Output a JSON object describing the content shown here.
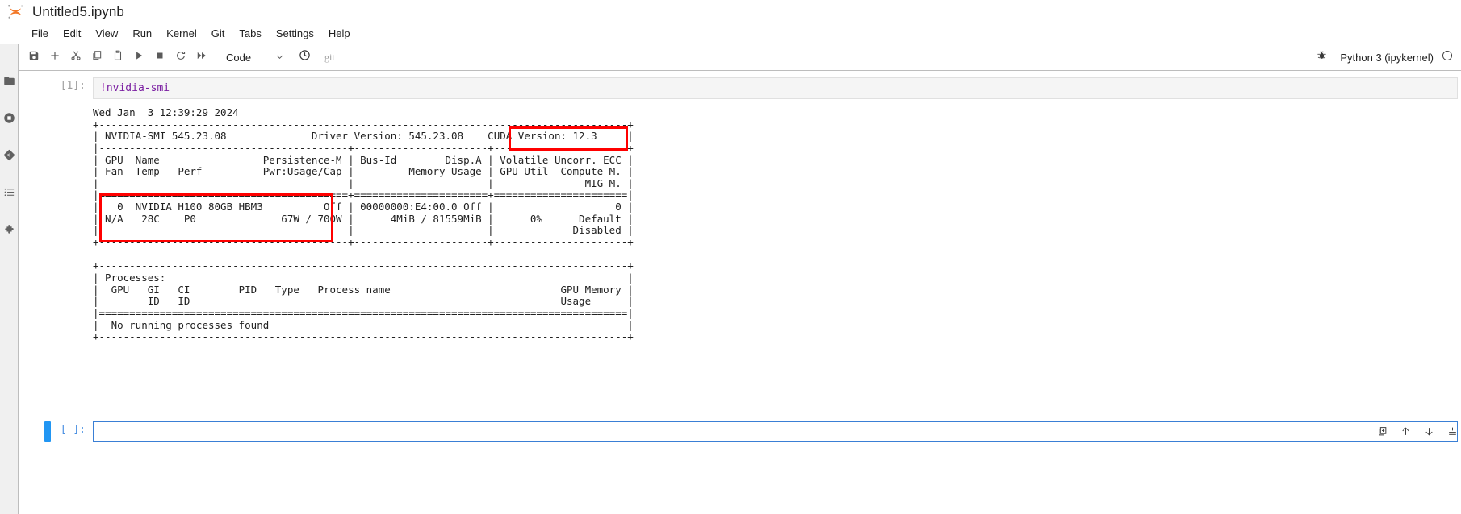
{
  "window": {
    "logo_icon": "jupyter-logo-icon",
    "title": "Untitled5.ipynb"
  },
  "menubar": {
    "items": [
      {
        "label": "File",
        "name": "menu-file"
      },
      {
        "label": "Edit",
        "name": "menu-edit"
      },
      {
        "label": "View",
        "name": "menu-view"
      },
      {
        "label": "Run",
        "name": "menu-run"
      },
      {
        "label": "Kernel",
        "name": "menu-kernel"
      },
      {
        "label": "Git",
        "name": "menu-git"
      },
      {
        "label": "Tabs",
        "name": "menu-tabs"
      },
      {
        "label": "Settings",
        "name": "menu-settings"
      },
      {
        "label": "Help",
        "name": "menu-help"
      }
    ]
  },
  "sidebar": {
    "items": [
      {
        "icon": "folder-icon",
        "name": "sidebar-item-file-browser"
      },
      {
        "icon": "running-terminals-icon",
        "name": "sidebar-item-running"
      },
      {
        "icon": "git-icon",
        "name": "sidebar-item-git"
      },
      {
        "icon": "table-of-contents-icon",
        "name": "sidebar-item-toc"
      },
      {
        "icon": "extension-puzzle-icon",
        "name": "sidebar-item-extensions"
      }
    ]
  },
  "toolbar": {
    "buttons": [
      {
        "icon": "save-icon",
        "name": "save-button"
      },
      {
        "icon": "plus-icon",
        "name": "insert-cell-button"
      },
      {
        "icon": "scissors-icon",
        "name": "cut-cells-button"
      },
      {
        "icon": "copy-icon",
        "name": "copy-cells-button"
      },
      {
        "icon": "paste-icon",
        "name": "paste-cells-button"
      },
      {
        "icon": "play-icon",
        "name": "run-cell-button"
      },
      {
        "icon": "stop-square-icon",
        "name": "interrupt-kernel-button"
      },
      {
        "icon": "restart-circular-arrow-icon",
        "name": "restart-kernel-button"
      },
      {
        "icon": "fast-forward-icon",
        "name": "restart-and-run-all-button"
      }
    ],
    "cell_type": "Code",
    "cell_type_caret": "chevron-down-icon",
    "history_icon": "clock-icon",
    "git_label": "git",
    "debugger_icon": "bug-icon",
    "kernel_name": "Python 3 (ipykernel)",
    "kernel_status_icon": "kernel-idle-circle-icon"
  },
  "notebook": {
    "cells": [
      {
        "name": "code-cell-1",
        "prompt": "[1]:",
        "source_bang": "!",
        "source_cmd": "nvidia-smi",
        "output_lines": [
          "Wed Jan  3 12:39:29 2024",
          "+---------------------------------------------------------------------------------------+",
          "| NVIDIA-SMI 545.23.08              Driver Version: 545.23.08    CUDA Version: 12.3     |",
          "|-----------------------------------------+----------------------+----------------------+",
          "| GPU  Name                 Persistence-M | Bus-Id        Disp.A | Volatile Uncorr. ECC |",
          "| Fan  Temp   Perf          Pwr:Usage/Cap |         Memory-Usage | GPU-Util  Compute M. |",
          "|                                         |                      |               MIG M. |",
          "|=========================================+======================+======================|",
          "|   0  NVIDIA H100 80GB HBM3          Off | 00000000:E4:00.0 Off |                    0 |",
          "| N/A   28C    P0              67W / 700W |      4MiB / 81559MiB |      0%      Default |",
          "|                                         |                      |             Disabled |",
          "+-----------------------------------------+----------------------+----------------------+",
          "",
          "+---------------------------------------------------------------------------------------+",
          "| Processes:                                                                            |",
          "|  GPU   GI   CI        PID   Type   Process name                            GPU Memory |",
          "|        ID   ID                                                             Usage      |",
          "|=======================================================================================|",
          "|  No running processes found                                                           |",
          "+---------------------------------------------------------------------------------------+"
        ],
        "annotations": [
          {
            "name": "cuda-version-highlight",
            "color": "#ff0000",
            "label": "CUDA Version: 12.3"
          },
          {
            "name": "gpu-row-highlight",
            "color": "#ff0000",
            "label": "0  NVIDIA H100 80GB HBM3  Off / N/A 28C P0 67W / 700W"
          }
        ]
      },
      {
        "name": "code-cell-2",
        "prompt": "[ ]:",
        "source_bang": "",
        "source_cmd": "",
        "placeholder": ""
      }
    ]
  },
  "cell_toolbar": {
    "buttons": [
      {
        "icon": "duplicate-cell-icon",
        "name": "duplicate-cell-button"
      },
      {
        "icon": "arrow-up-icon",
        "name": "move-cell-up-button"
      },
      {
        "icon": "arrow-down-icon",
        "name": "move-cell-down-button"
      },
      {
        "icon": "insert-cell-above-icon",
        "name": "insert-cell-above-button"
      },
      {
        "icon": "insert-cell-below-icon",
        "name": "insert-cell-below-button"
      },
      {
        "icon": "trash-icon",
        "name": "delete-cell-button"
      }
    ]
  },
  "colors": {
    "accent": "#2196f3",
    "annotation": "#ff0000",
    "logo_orange": "#f37726"
  }
}
